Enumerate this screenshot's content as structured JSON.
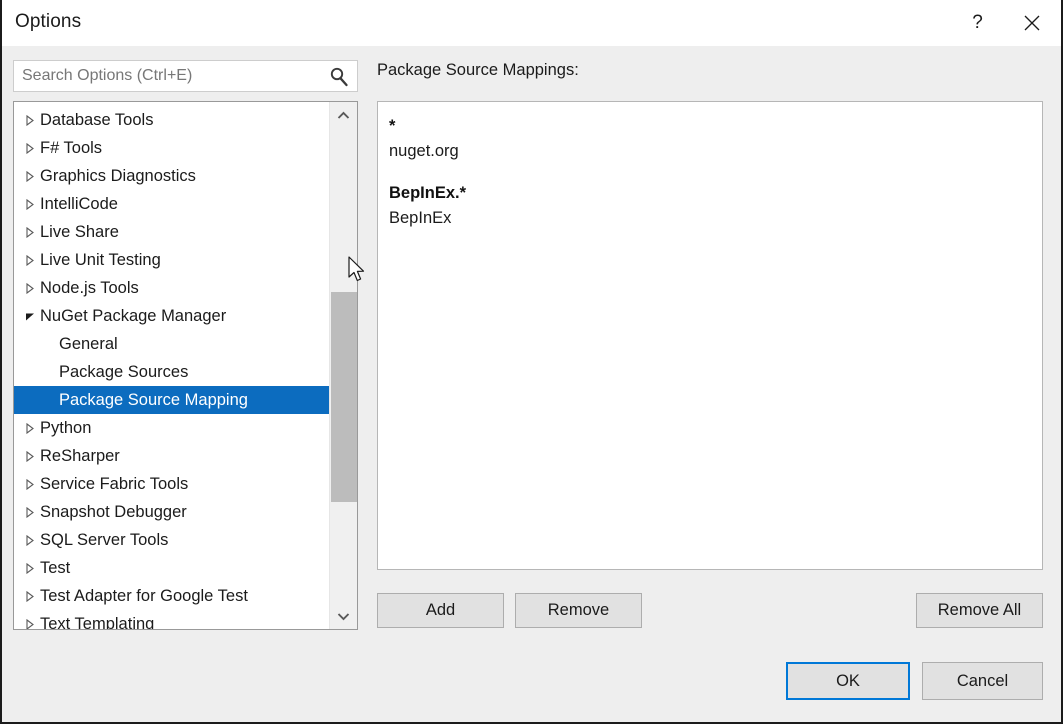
{
  "window": {
    "title": "Options",
    "help_icon": "question-mark-icon",
    "close_icon": "close-icon"
  },
  "search": {
    "placeholder": "Search Options (Ctrl+E)",
    "value": "",
    "icon": "search-icon"
  },
  "tree": {
    "items": [
      {
        "label": "Database Tools",
        "level": 0,
        "expandable": true,
        "expanded": false,
        "selected": false
      },
      {
        "label": "F# Tools",
        "level": 0,
        "expandable": true,
        "expanded": false,
        "selected": false
      },
      {
        "label": "Graphics Diagnostics",
        "level": 0,
        "expandable": true,
        "expanded": false,
        "selected": false
      },
      {
        "label": "IntelliCode",
        "level": 0,
        "expandable": true,
        "expanded": false,
        "selected": false
      },
      {
        "label": "Live Share",
        "level": 0,
        "expandable": true,
        "expanded": false,
        "selected": false
      },
      {
        "label": "Live Unit Testing",
        "level": 0,
        "expandable": true,
        "expanded": false,
        "selected": false
      },
      {
        "label": "Node.js Tools",
        "level": 0,
        "expandable": true,
        "expanded": false,
        "selected": false
      },
      {
        "label": "NuGet Package Manager",
        "level": 0,
        "expandable": true,
        "expanded": true,
        "selected": false
      },
      {
        "label": "General",
        "level": 1,
        "expandable": false,
        "expanded": false,
        "selected": false
      },
      {
        "label": "Package Sources",
        "level": 1,
        "expandable": false,
        "expanded": false,
        "selected": false
      },
      {
        "label": "Package Source Mapping",
        "level": 1,
        "expandable": false,
        "expanded": false,
        "selected": true
      },
      {
        "label": "Python",
        "level": 0,
        "expandable": true,
        "expanded": false,
        "selected": false
      },
      {
        "label": "ReSharper",
        "level": 0,
        "expandable": true,
        "expanded": false,
        "selected": false
      },
      {
        "label": "Service Fabric Tools",
        "level": 0,
        "expandable": true,
        "expanded": false,
        "selected": false
      },
      {
        "label": "Snapshot Debugger",
        "level": 0,
        "expandable": true,
        "expanded": false,
        "selected": false
      },
      {
        "label": "SQL Server Tools",
        "level": 0,
        "expandable": true,
        "expanded": false,
        "selected": false
      },
      {
        "label": "Test",
        "level": 0,
        "expandable": true,
        "expanded": false,
        "selected": false
      },
      {
        "label": "Test Adapter for Google Test",
        "level": 0,
        "expandable": true,
        "expanded": false,
        "selected": false
      },
      {
        "label": "Text Templating",
        "level": 0,
        "expandable": true,
        "expanded": false,
        "selected": false
      }
    ],
    "scrollbar": {
      "up_icon": "chevron-up-icon",
      "down_icon": "chevron-down-icon"
    }
  },
  "right_pane": {
    "heading": "Package Source Mappings:",
    "mappings": [
      {
        "pattern": "*",
        "sources": [
          "nuget.org"
        ]
      },
      {
        "pattern": "BepInEx.*",
        "sources": [
          "BepInEx"
        ]
      }
    ],
    "buttons": {
      "add": "Add",
      "remove": "Remove",
      "remove_all": "Remove All"
    }
  },
  "footer": {
    "ok": "OK",
    "cancel": "Cancel"
  },
  "colors": {
    "selection": "#0c6cbf",
    "focus_border": "#0078d7",
    "dialog_background": "#eeeeee",
    "button_face": "#e1e1e1"
  }
}
